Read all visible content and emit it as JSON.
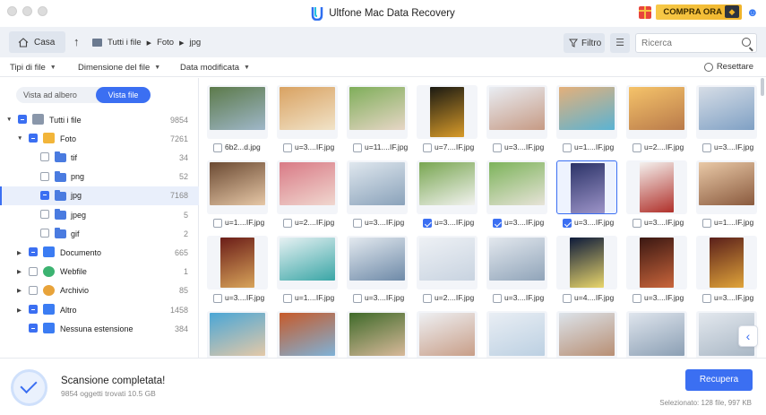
{
  "app": {
    "title": "Ultfone Mac Data Recovery",
    "buy_label": "COMPRA ORA"
  },
  "nav": {
    "home_label": "Casa",
    "breadcrumb": [
      "Tutti i file",
      "Foto",
      "jpg"
    ],
    "filter_label": "Filtro",
    "search_placeholder": "Ricerca"
  },
  "filters": {
    "file_types": "Tipi di file",
    "file_size": "Dimensione del file",
    "date_modified": "Data modificata",
    "reset": "Resettare"
  },
  "view": {
    "tree_view": "Vista ad albero",
    "file_view": "Vista file"
  },
  "tree": [
    {
      "label": "Tutti i file",
      "count": "9854",
      "level": 0,
      "expanded": true,
      "check": "partial",
      "icon": "drive-icon"
    },
    {
      "label": "Foto",
      "count": "7261",
      "level": 1,
      "expanded": true,
      "check": "partial",
      "icon": "photos-icon"
    },
    {
      "label": "tif",
      "count": "34",
      "level": 2,
      "check": "none",
      "icon": "folder-icon"
    },
    {
      "label": "png",
      "count": "52",
      "level": 2,
      "check": "none",
      "icon": "folder-icon"
    },
    {
      "label": "jpg",
      "count": "7168",
      "level": 2,
      "check": "partial",
      "icon": "folder-icon",
      "selected": true
    },
    {
      "label": "jpeg",
      "count": "5",
      "level": 2,
      "check": "none",
      "icon": "folder-icon"
    },
    {
      "label": "gif",
      "count": "2",
      "level": 2,
      "check": "none",
      "icon": "folder-icon"
    },
    {
      "label": "Documento",
      "count": "665",
      "level": 1,
      "expanded": false,
      "check": "partial",
      "icon": "document-icon"
    },
    {
      "label": "Webfile",
      "count": "1",
      "level": 1,
      "expanded": false,
      "check": "none",
      "icon": "webfile-icon"
    },
    {
      "label": "Archivio",
      "count": "85",
      "level": 1,
      "expanded": false,
      "check": "none",
      "icon": "archive-icon"
    },
    {
      "label": "Altro",
      "count": "1458",
      "level": 1,
      "expanded": false,
      "check": "partial",
      "icon": "other-icon"
    },
    {
      "label": "Nessuna estensione",
      "count": "384",
      "level": 1,
      "check": "partial",
      "icon": "unknown-ext-icon"
    }
  ],
  "files": [
    {
      "name": "6b2...d.jpg",
      "checked": false
    },
    {
      "name": "u=3....IF.jpg",
      "checked": false
    },
    {
      "name": "u=11....IF.jpg",
      "checked": false
    },
    {
      "name": "u=7....IF.jpg",
      "checked": false
    },
    {
      "name": "u=3....IF.jpg",
      "checked": false
    },
    {
      "name": "u=1....IF.jpg",
      "checked": false
    },
    {
      "name": "u=2....IF.jpg",
      "checked": false
    },
    {
      "name": "u=3....IF.jpg",
      "checked": false
    },
    {
      "name": "u=1....IF.jpg",
      "checked": false
    },
    {
      "name": "u=2....IF.jpg",
      "checked": false
    },
    {
      "name": "u=3....IF.jpg",
      "checked": false
    },
    {
      "name": "u=3....IF.jpg",
      "checked": true
    },
    {
      "name": "u=3....IF.jpg",
      "checked": true
    },
    {
      "name": "u=3....IF.jpg",
      "checked": true,
      "selected": true
    },
    {
      "name": "u=3....IF.jpg",
      "checked": false
    },
    {
      "name": "u=1....IF.jpg",
      "checked": false
    },
    {
      "name": "u=3....IF.jpg",
      "checked": false
    },
    {
      "name": "u=1....IF.jpg",
      "checked": false
    },
    {
      "name": "u=3....IF.jpg",
      "checked": false
    },
    {
      "name": "u=2....IF.jpg",
      "checked": false
    },
    {
      "name": "u=3....IF.jpg",
      "checked": false
    },
    {
      "name": "u=4....IF.jpg",
      "checked": false
    },
    {
      "name": "u=3....IF.jpg",
      "checked": false
    },
    {
      "name": "u=3....IF.jpg",
      "checked": false
    },
    {
      "name": "",
      "checked": false
    },
    {
      "name": "",
      "checked": false
    },
    {
      "name": "",
      "checked": false
    },
    {
      "name": "",
      "checked": false
    },
    {
      "name": "",
      "checked": false
    },
    {
      "name": "",
      "checked": false
    },
    {
      "name": "",
      "checked": false
    },
    {
      "name": "",
      "checked": false
    }
  ],
  "thumb_colors": [
    [
      "#5c7a4a",
      "#9fb7c9"
    ],
    [
      "#d9a262",
      "#f1e3c8"
    ],
    [
      "#7fae5a",
      "#e7d6c6"
    ],
    [
      "#1b1a12",
      "#d89b2a"
    ],
    [
      "#e9edf3",
      "#c69a84"
    ],
    [
      "#e4b07a",
      "#5ab3d3"
    ],
    [
      "#f5c36a",
      "#b97a4a"
    ],
    [
      "#d6dde6",
      "#7fa0c4"
    ],
    [
      "#6b4a33",
      "#e6c7a6"
    ],
    [
      "#d97a86",
      "#f0d7cf"
    ],
    [
      "#dfe7ee",
      "#8aa2ba"
    ],
    [
      "#78a651",
      "#f2f2ef"
    ],
    [
      "#7cb35a",
      "#e7e3d8"
    ],
    [
      "#2b3368",
      "#9d94c8"
    ],
    [
      "#f4f1ee",
      "#b0302a"
    ],
    [
      "#e9c9a7",
      "#8a5a3e"
    ],
    [
      "#6b1d18",
      "#d8a45a"
    ],
    [
      "#e7f1f3",
      "#3aa6a6"
    ],
    [
      "#e3e9ef",
      "#6e8aa8"
    ],
    [
      "#eef1f5",
      "#c8d3e0"
    ],
    [
      "#e3e8ee",
      "#90a4b9"
    ],
    [
      "#0d1a3a",
      "#e9d66b"
    ],
    [
      "#3a1712",
      "#c9653b"
    ],
    [
      "#5a1f1a",
      "#e0a43a"
    ],
    [
      "#4aa6d6",
      "#e4c9a8"
    ],
    [
      "#c65a2a",
      "#7fb2d8"
    ],
    [
      "#3f6a2a",
      "#d8b99a"
    ],
    [
      "#eef0f3",
      "#c89e88"
    ],
    [
      "#e9eef4",
      "#bcd0e2"
    ],
    [
      "#dce3ea",
      "#b88f74"
    ],
    [
      "#dfe5ed",
      "#8b9fb4"
    ],
    [
      "#e3e8ee",
      "#a9b7c5"
    ]
  ],
  "footer": {
    "status_title": "Scansione completata!",
    "status_sub": "9854 oggetti trovati 10.5 GB",
    "recover_label": "Recupera",
    "selection_info": "Selezionato: 128 file, 997 KB"
  }
}
